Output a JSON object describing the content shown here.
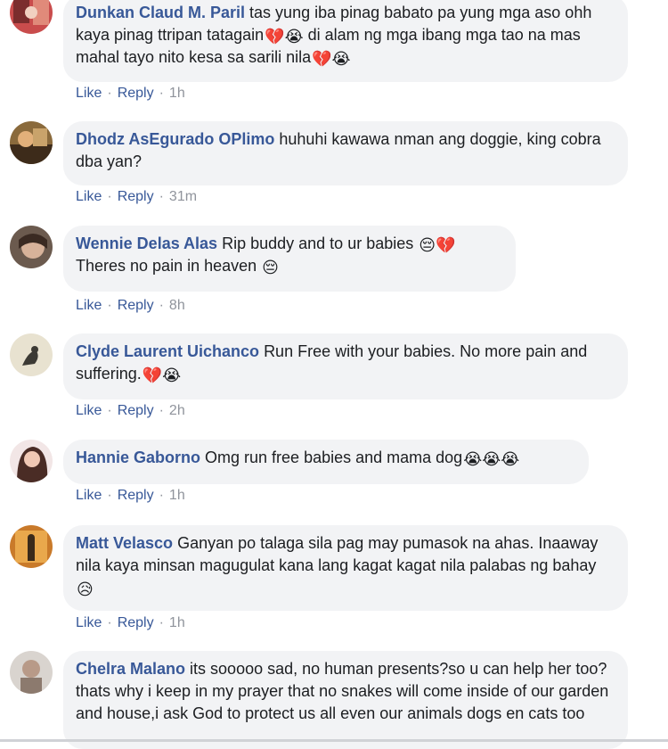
{
  "actions": {
    "like": "Like",
    "reply": "Reply",
    "separator": "·"
  },
  "comments": [
    {
      "author": "Dunkan Claud M. Paril",
      "text": "tas yung iba pinag babato pa yung mga aso ohh kaya pinag ttripan tatagain",
      "emoji1": "💔😭",
      "text2": " di alam ng mga ibang mga tao na mas mahal tayo nito kesa sa sarili nila",
      "emoji2": "💔😭",
      "time": "1h"
    },
    {
      "author": "Dhodz AsEgurado OPlimo",
      "text": "huhuhi kawawa nman ang doggie, king cobra dba yan?",
      "time": "31m"
    },
    {
      "author": "Wennie Delas Alas",
      "text": "Rip buddy and to ur babies ",
      "emoji1": "😔💔",
      "text2": "Theres no pain in heaven ",
      "emoji2": "😔",
      "time": "8h"
    },
    {
      "author": "Clyde Laurent Uichanco",
      "text": "Run Free with your babies. No more pain and suffering.",
      "emoji1": "💔😭",
      "time": "2h"
    },
    {
      "author": "Hannie Gaborno",
      "text": "Omg run free babies and mama dog",
      "emoji1": "😭😭😭",
      "time": "1h"
    },
    {
      "author": "Matt Velasco",
      "text": "Ganyan po talaga sila pag may pumasok na ahas. Inaaway nila kaya minsan magugulat kana lang kagat kagat nila palabas ng bahay ",
      "emoji1": "😥",
      "time": "1h"
    },
    {
      "author": "Chelra Malano",
      "text": "its sooooo sad, no human presents?so u can help her too?thats why i keep in my prayer that no snakes will come inside of our garden and house,i ask God to protect us all even our animals dogs en cats too"
    }
  ]
}
